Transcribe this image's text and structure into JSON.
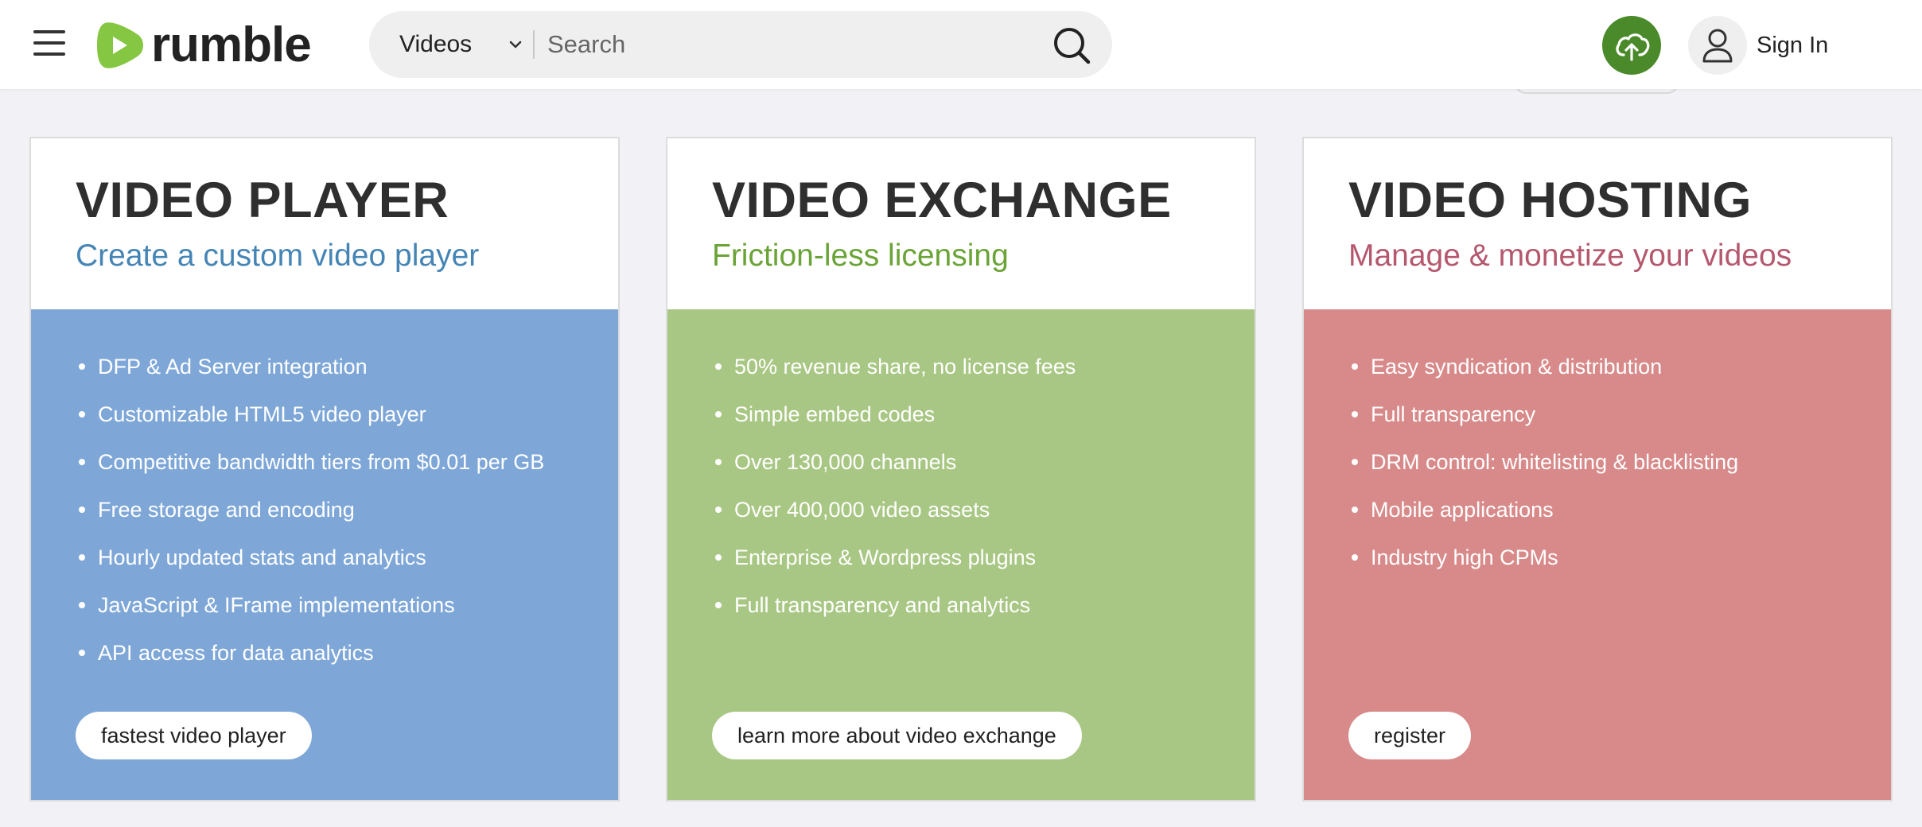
{
  "header": {
    "logo_text": "rumble",
    "search": {
      "category": "Videos",
      "placeholder": "Search"
    },
    "sign_in_label": "Sign In"
  },
  "colors": {
    "brand_green": "#85c742",
    "upload_green": "#4a8a2a",
    "player_accent": "#4585b5",
    "exchange_accent": "#6aa336",
    "hosting_accent": "#b5586e",
    "player_body": "#7ea7d8",
    "exchange_body": "#a9c784",
    "hosting_body": "#d88a8a"
  },
  "cards": [
    {
      "title": "VIDEO PLAYER",
      "subtitle": "Create a custom video player",
      "features": [
        "DFP & Ad Server integration",
        "Customizable HTML5 video player",
        "Competitive bandwidth tiers from $0.01 per GB",
        "Free storage and encoding",
        "Hourly updated stats and analytics",
        "JavaScript & IFrame implementations",
        "API access for data analytics"
      ],
      "button_label": "fastest video player"
    },
    {
      "title": "VIDEO EXCHANGE",
      "subtitle": "Friction-less licensing",
      "features": [
        "50% revenue share, no license fees",
        "Simple embed codes",
        "Over 130,000 channels",
        "Over 400,000 video assets",
        "Enterprise & Wordpress plugins",
        "Full transparency and analytics"
      ],
      "button_label": "learn more about video exchange"
    },
    {
      "title": "VIDEO HOSTING",
      "subtitle": "Manage & monetize your videos",
      "features": [
        "Easy syndication & distribution",
        "Full transparency",
        "DRM control: whitelisting & blacklisting",
        "Mobile applications",
        "Industry high CPMs"
      ],
      "button_label": "register"
    }
  ]
}
